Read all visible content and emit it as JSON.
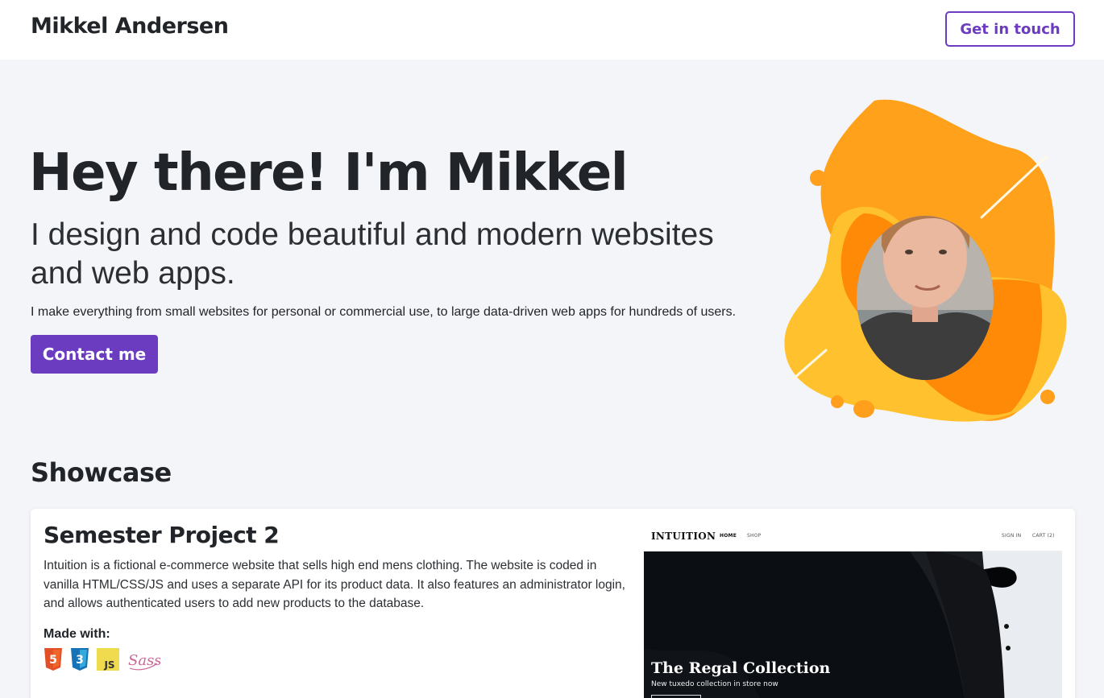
{
  "navbar": {
    "brand": "Mikkel Andersen",
    "cta_label": "Get in touch"
  },
  "hero": {
    "title": "Hey there! I'm Mikkel",
    "subtitle": "I design and code beautiful and modern websites and web apps.",
    "text": "I make everything from small websites for personal or commercial use, to large data-driven web apps for hundreds of users.",
    "cta_label": "Contact me",
    "colors": {
      "blob_dark": "#ff9f1c",
      "blob_light": "#ffc43d",
      "overlap": "#ff7f00",
      "accent": "#6b3cc0"
    }
  },
  "showcase": {
    "title": "Showcase",
    "projects": [
      {
        "title": "Semester Project 2",
        "description": "Intuition is a fictional e-commerce website that sells high end mens clothing. The website is coded in vanilla HTML/CSS/JS and uses a separate API for its product data. It also features an administrator login, and allows authenticated users to add new products to the database.",
        "made_with_label": "Made with:",
        "tech": [
          "html5-icon",
          "css3-icon",
          "javascript-icon",
          "sass-icon"
        ],
        "preview": {
          "brand": "INTUITION",
          "nav": [
            "HOME",
            "SHOP"
          ],
          "nav_right": [
            "SIGN IN",
            "CART (2)"
          ],
          "hero_title": "The Regal Collection",
          "hero_sub": "New tuxedo collection in store now"
        }
      }
    ]
  }
}
